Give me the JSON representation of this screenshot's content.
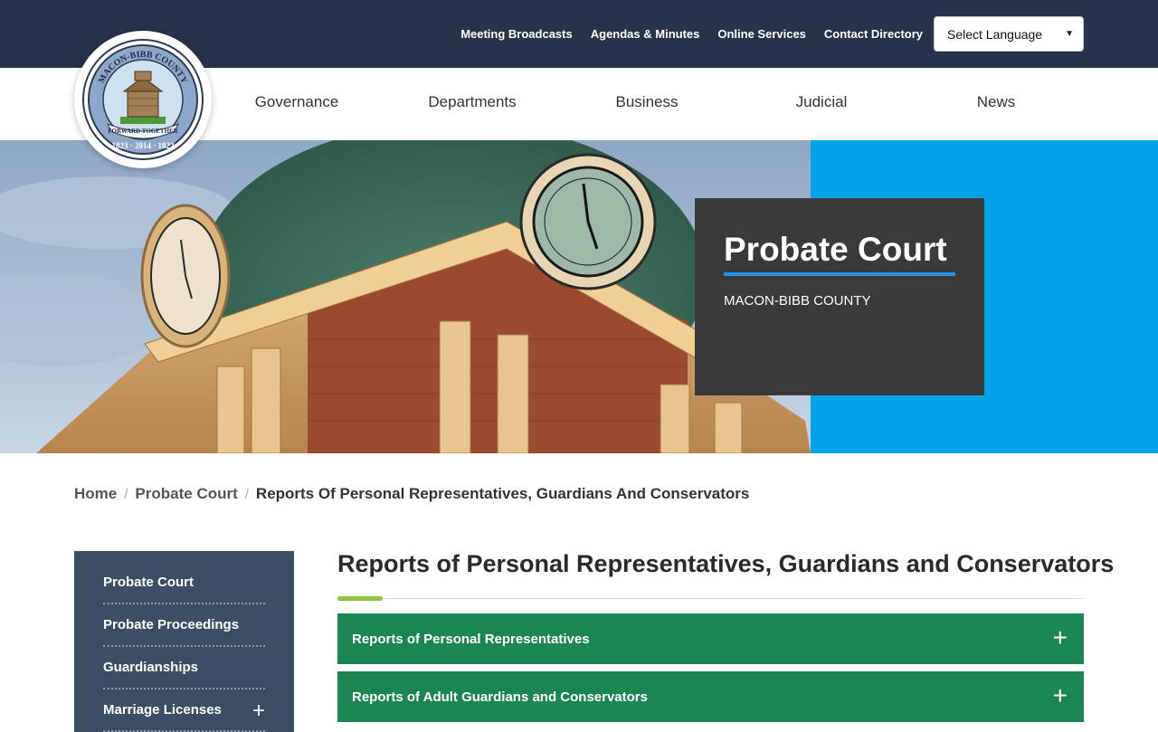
{
  "utility_nav": {
    "links": [
      "Meeting Broadcasts",
      "Agendas & Minutes",
      "Online Services",
      "Contact Directory"
    ],
    "language_select": "Select Language"
  },
  "logo": {
    "text_top": "MACON-BIBB COUNTY",
    "motto": "FORWARD TOGETHER",
    "years": "1823 · 2014 · 1822"
  },
  "main_nav": [
    "Governance",
    "Departments",
    "Business",
    "Judicial",
    "News"
  ],
  "hero": {
    "title": "Probate Court",
    "subtitle": "MACON-BIBB COUNTY"
  },
  "breadcrumb": {
    "home": "Home",
    "parent": "Probate Court",
    "current": "Reports Of Personal Representatives, Guardians And Conservators",
    "separator": "/"
  },
  "sidebar": {
    "items": [
      {
        "label": "Probate Court",
        "expandable": false
      },
      {
        "label": "Probate Proceedings",
        "expandable": false
      },
      {
        "label": "Guardianships",
        "expandable": false
      },
      {
        "label": "Marriage Licenses",
        "expandable": true
      }
    ],
    "expand_glyph": "+"
  },
  "content": {
    "title": "Reports of Personal Representatives, Guardians and Conservators",
    "accordions": [
      {
        "label": "Reports of Personal Representatives"
      },
      {
        "label": "Reports of Adult Guardians and Conservators"
      }
    ],
    "expand_glyph": "+"
  },
  "colors": {
    "topbar": "#283249",
    "hero_blue": "#00a3e8",
    "hero_card": "#3a3a3a",
    "accordion_green": "#1b8553",
    "sidebar_bg": "#3d4e63",
    "accent_green": "#8cc63f"
  }
}
